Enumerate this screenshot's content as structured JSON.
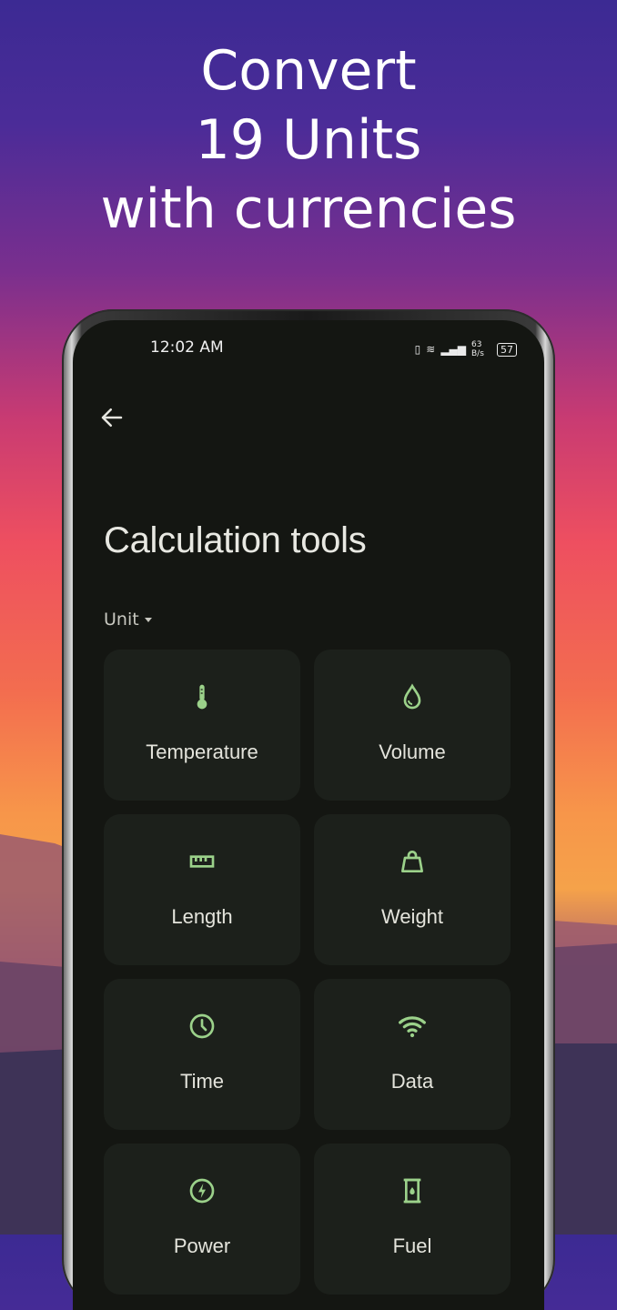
{
  "headline": {
    "line1": "Convert",
    "line2": "19 Units",
    "line3": "with currencies"
  },
  "status_bar": {
    "time": "12:02 AM",
    "net_speed": "63 B/s",
    "battery": "57"
  },
  "page": {
    "title": "Calculation tools",
    "category_dropdown": "Unit"
  },
  "tools": [
    {
      "label": "Temperature",
      "icon": "thermometer-icon"
    },
    {
      "label": "Volume",
      "icon": "water-drop-icon"
    },
    {
      "label": "Length",
      "icon": "ruler-icon"
    },
    {
      "label": "Weight",
      "icon": "weight-bag-icon"
    },
    {
      "label": "Time",
      "icon": "clock-icon"
    },
    {
      "label": "Data",
      "icon": "wifi-icon"
    },
    {
      "label": "Power",
      "icon": "bolt-icon"
    },
    {
      "label": "Fuel",
      "icon": "fuel-barrel-icon"
    }
  ],
  "colors": {
    "accent": "#9bd18a",
    "screen_bg": "#141612",
    "card_bg": "#1c201b"
  }
}
